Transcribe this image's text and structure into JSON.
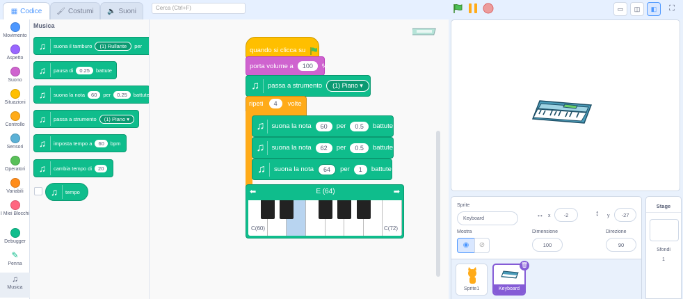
{
  "tabs": {
    "code": "Codice",
    "costumes": "Costumi",
    "sounds": "Suoni"
  },
  "search": {
    "placeholder": "Cerca (Ctrl+F)"
  },
  "categories": [
    {
      "label": "Movimento",
      "color": "#4c97ff"
    },
    {
      "label": "Aspetto",
      "color": "#9966ff"
    },
    {
      "label": "Suono",
      "color": "#cf63cf"
    },
    {
      "label": "Situazioni",
      "color": "#ffbf00"
    },
    {
      "label": "Controllo",
      "color": "#ffab19"
    },
    {
      "label": "Sensori",
      "color": "#5cb1d6"
    },
    {
      "label": "Operatori",
      "color": "#59c059"
    },
    {
      "label": "Variabili",
      "color": "#ff8c1a"
    },
    {
      "label": "I Miei Blocchi",
      "color": "#ff6680"
    },
    {
      "label": "Debugger",
      "color": "#0fbd8c"
    },
    {
      "label": "Penna",
      "color": "#0fbd8c"
    },
    {
      "label": "Musica",
      "color": "#0fbd8c"
    }
  ],
  "palette": {
    "title": "Musica",
    "drum": {
      "text": "suona il tamburo",
      "value": "(1) Rullante",
      "suffix": "per"
    },
    "rest": {
      "text": "pausa di",
      "value": "0.25",
      "suffix": "battute"
    },
    "note": {
      "text": "suona la nota",
      "note": "60",
      "mid": "per",
      "beats": "0.25",
      "suffix": "battute"
    },
    "instrument": {
      "text": "passa a strumento",
      "value": "(1) Piano"
    },
    "settempo": {
      "text": "imposta tempo a",
      "value": "60",
      "suffix": "bpm"
    },
    "changetempo": {
      "text": "cambia tempo di",
      "value": "20"
    },
    "tempo": {
      "text": "tempo"
    }
  },
  "script": {
    "hat": "quando si clicca su",
    "volume": {
      "text": "porta volume a",
      "value": "100",
      "suffix": "%"
    },
    "instrument": {
      "text": "passa a strumento",
      "value": "(1) Piano"
    },
    "repeat": {
      "text": "ripeti",
      "value": "4",
      "suffix": "volte"
    },
    "notes": [
      {
        "text": "suona la nota",
        "note": "60",
        "mid": "per",
        "beats": "0.5",
        "suffix": "battute"
      },
      {
        "text": "suona la nota",
        "note": "62",
        "mid": "per",
        "beats": "0.5",
        "suffix": "battute"
      },
      {
        "text": "suona la nota",
        "note": "64",
        "mid": "per",
        "beats": "1",
        "suffix": "battute"
      }
    ]
  },
  "piano": {
    "title": "E (64)",
    "low": "C(60)",
    "high": "C(72)"
  },
  "sprite_info": {
    "label": "Sprite",
    "name": "Keyboard",
    "x_label": "x",
    "x": "-2",
    "y_label": "y",
    "y": "-27",
    "show_label": "Mostra",
    "size_label": "Dimensione",
    "size": "100",
    "dir_label": "Direzione",
    "dir": "90"
  },
  "sprites": [
    {
      "name": "Sprite1"
    },
    {
      "name": "Keyboard"
    }
  ],
  "stage_panel": {
    "title": "Stage",
    "backdrops_label": "Sfondi",
    "backdrops": "1"
  },
  "colors": {
    "music": "#0fbd8c",
    "events": "#ffbf00",
    "sound": "#cf63cf",
    "control": "#ffab19",
    "accent": "#4c97ff",
    "selected": "#855cd6"
  }
}
